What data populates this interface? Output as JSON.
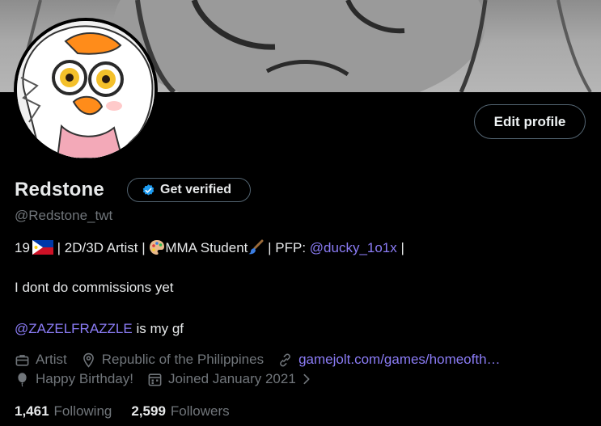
{
  "profile": {
    "name": "Redstone",
    "handle": "@Redstone_twt",
    "edit_profile_label": "Edit profile",
    "get_verified_label": "Get verified"
  },
  "bio": {
    "line1_prefix": "19",
    "line1_mid1": " | 2D/3D Artist | ",
    "line1_mid2": "MMA Student",
    "line1_mid3": " | PFP: ",
    "line1_link": "@ducky_1o1x",
    "line1_suffix": " |",
    "line2": "I dont do commissions yet",
    "line3_link": "@ZAZELFRAZZLE",
    "line3_text": " is my gf"
  },
  "meta": {
    "category": "Artist",
    "location": "Republic of the Philippines",
    "website": "gamejolt.com/games/homeofth…",
    "birthday": "Happy Birthday!",
    "joined": "Joined January 2021"
  },
  "stats": {
    "following_count": "1,461",
    "following_label": "Following",
    "followers_count": "2,599",
    "followers_label": "Followers"
  },
  "colors": {
    "background": "#000000",
    "link": "#8b7cf6",
    "muted": "#71767b",
    "verified_badge": "#1d9bf0"
  },
  "icons": [
    "verified-badge-icon",
    "philippines-flag-icon",
    "palette-icon",
    "paintbrush-icon",
    "briefcase-icon",
    "location-pin-icon",
    "link-icon",
    "balloon-icon",
    "calendar-icon",
    "chevron-right-icon"
  ]
}
